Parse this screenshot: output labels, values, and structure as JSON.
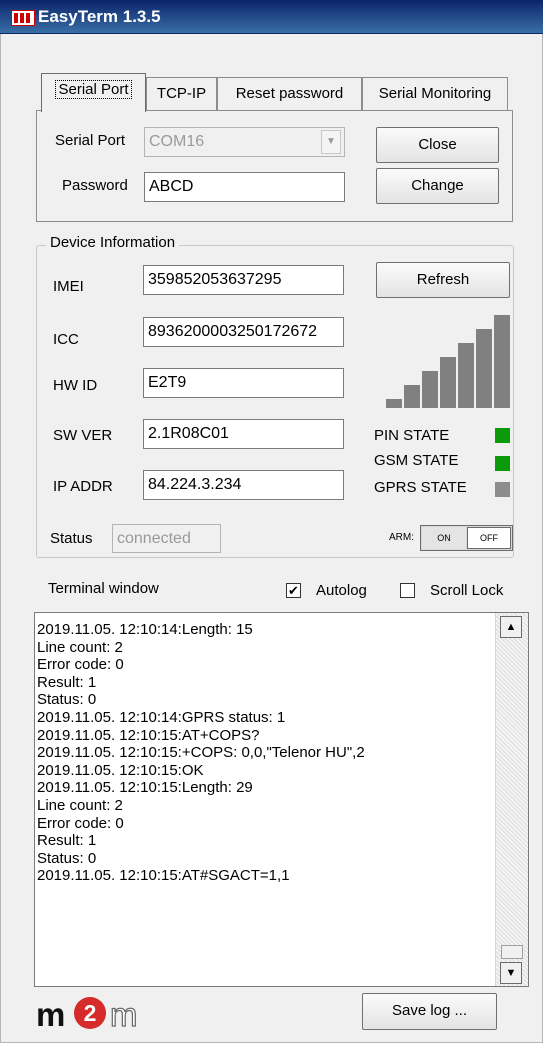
{
  "window": {
    "title": "EasyTerm 1.3.5"
  },
  "tabs": [
    "Serial Port",
    "TCP-IP",
    "Reset password",
    "Serial Monitoring"
  ],
  "serial": {
    "port_label": "Serial Port",
    "port_value": "COM16",
    "password_label": "Password",
    "password_value": "ABCD",
    "close_label": "Close",
    "change_label": "Change"
  },
  "device": {
    "group_title": "Device Information",
    "imei_label": "IMEI",
    "imei_value": "359852053637295",
    "icc_label": "ICC",
    "icc_value": "8936200003250172672",
    "hwid_label": "HW ID",
    "hwid_value": "E2T9",
    "swver_label": "SW VER",
    "swver_value": "2.1R08C01",
    "ipaddr_label": "IP ADDR",
    "ipaddr_value": "84.224.3.234",
    "refresh_label": "Refresh",
    "signal_bars_lit": 7,
    "pin_state_label": "PIN STATE",
    "gsm_state_label": "GSM STATE",
    "gprs_state_label": "GPRS STATE",
    "pin_state_color": "#0a9a0a",
    "gsm_state_color": "#0a9a0a",
    "gprs_state_color": "#8c8c8c",
    "status_label": "Status",
    "status_value": "connected",
    "arm_label": "ARM:",
    "arm_on": "ON",
    "arm_off": "OFF"
  },
  "terminal": {
    "label": "Terminal window",
    "autolog_label": "Autolog",
    "autolog_checked": true,
    "scrolllock_label": "Scroll Lock",
    "scrolllock_checked": false,
    "lines": [
      "2019.11.05. 12:10:14:Length: 15",
      "Line count: 2",
      "Error code: 0",
      "Result: 1",
      "Status: 0",
      "2019.11.05. 12:10:14:GPRS status: 1",
      "2019.11.05. 12:10:15:AT+COPS?",
      "2019.11.05. 12:10:15:+COPS: 0,0,\"Telenor HU\",2",
      "2019.11.05. 12:10:15:OK",
      "2019.11.05. 12:10:15:Length: 29",
      "Line count: 2",
      "Error code: 0",
      "Result: 1",
      "Status: 0",
      "2019.11.05. 12:10:15:AT#SGACT=1,1"
    ]
  },
  "footer": {
    "logo_text": "m2m",
    "save_log_label": "Save log ..."
  },
  "icons": {
    "app": "m2m-app-icon",
    "scroll_up": "arrow-up-icon",
    "scroll_down": "arrow-down-icon",
    "dropdown": "chevron-down-icon"
  }
}
